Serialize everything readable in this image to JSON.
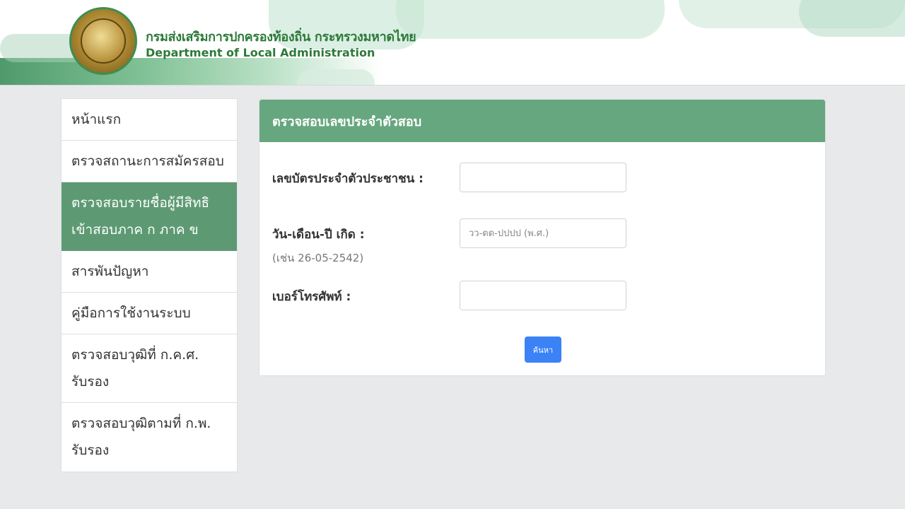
{
  "header": {
    "title_th": "กรมส่งเสริมการปกครองท้องถิ่น กระทรวงมหาดไทย",
    "title_en": "Department of Local Administration"
  },
  "sidebar": {
    "items": [
      {
        "label": "หน้าแรก",
        "active": false
      },
      {
        "label": "ตรวจสถานะการสมัครสอบ",
        "active": false
      },
      {
        "label": "ตรวจสอบรายชื่อผู้มีสิทธิเข้าสอบภาค ก ภาค ข",
        "active": true
      },
      {
        "label": "สารพันปัญหา",
        "active": false
      },
      {
        "label": "คู่มือการใช้งานระบบ",
        "active": false
      },
      {
        "label": "ตรวจสอบวุฒิที่ ก.ค.ศ. รับรอง",
        "active": false
      },
      {
        "label": "ตรวจสอบวุฒิตามที่ ก.พ. รับรอง",
        "active": false
      }
    ]
  },
  "form": {
    "heading": "ตรวจสอบเลขประจำตัวสอบ",
    "id_label": "เลขบัตรประจำตัวประชาชน :",
    "id_value": "",
    "dob_label": "วัน-เดือน-ปี เกิด :",
    "dob_hint": "(เช่น 26-05-2542)",
    "dob_placeholder": "วว-ดด-ปปปป (พ.ศ.)",
    "phone_label": "เบอร์โทรศัพท์ :",
    "phone_value": "",
    "search_label": "ค้นหา"
  },
  "colors": {
    "header_green": "#2d7a3a",
    "sidebar_active": "#5d9a73",
    "card_header": "#66a77f",
    "button": "#3b82f6"
  }
}
